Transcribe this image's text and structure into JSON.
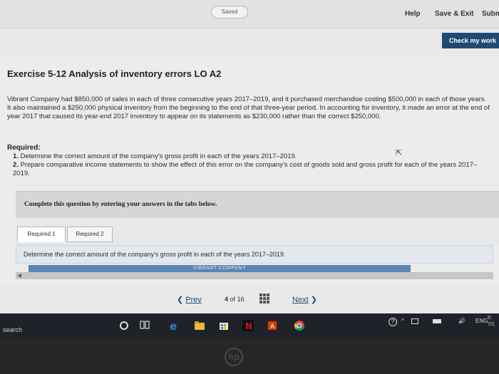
{
  "header": {
    "saved_label": "Saved",
    "help_label": "Help",
    "save_exit_label": "Save & Exit",
    "submit_label": "Subm",
    "check_work_label": "Check my work"
  },
  "exercise": {
    "title": "Exercise 5-12 Analysis of inventory errors LO A2",
    "paragraph": "Vibrant Company had $850,000 of sales in each of three consecutive years 2017–2019, and it purchased merchandise costing $500,000 in each of those years. It also maintained a $250,000 physical inventory from the beginning to the end of that three-year period. In accounting for inventory, it made an error at the end of year 2017 that caused its year-end 2017 inventory to appear on its statements as $230,000 rather than the correct $250,000.",
    "required_heading": "Required:",
    "required_items": [
      {
        "num": "1.",
        "text": "Determine the correct amount of the company's gross profit in each of the years 2017–2019."
      },
      {
        "num": "2.",
        "text": "Prepare comparative income statements to show the effect of this error on the company's cost of goods sold and gross profit for each of the years 2017–2019."
      }
    ]
  },
  "question": {
    "complete_text": "Complete this question by entering your answers in the tabs below.",
    "tabs": [
      {
        "label": "Required 1",
        "active": true
      },
      {
        "label": "Required 2",
        "active": false
      }
    ],
    "instruction": "Determine the correct amount of the company's gross profit in each of the years 2017–2019.",
    "company_header": "VIBRANT COMPANY"
  },
  "navigation": {
    "prev_label": "Prev",
    "page_current": "4",
    "page_of": "of",
    "page_total": "16",
    "next_label": "Next"
  },
  "taskbar": {
    "search_label": "search",
    "language": "ENG",
    "clock_line1": "5:",
    "clock_line2": "7/1"
  },
  "colors": {
    "accent": "#1f4b73",
    "company_bar": "#5a86b4"
  },
  "icons": [
    "task-view-icon",
    "edge-icon",
    "file-explorer-icon",
    "store-icon",
    "netflix-icon",
    "office-icon",
    "chrome-icon",
    "help-icon",
    "network-icon",
    "volume-icon",
    "battery-icon"
  ]
}
